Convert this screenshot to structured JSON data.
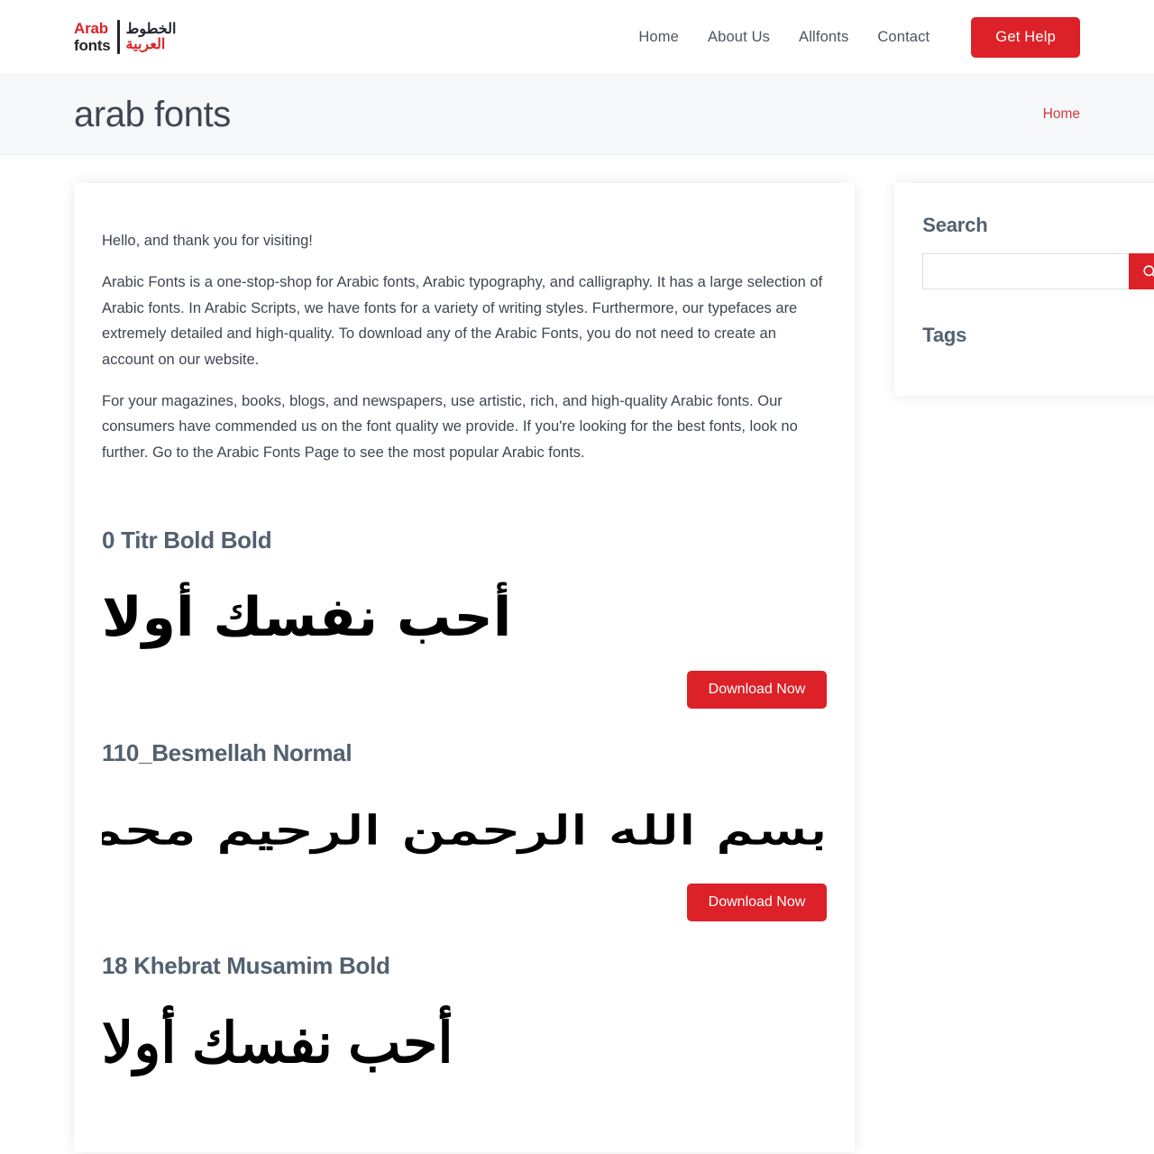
{
  "header": {
    "logo": {
      "latin_top": "Arab",
      "latin_bottom": "fonts",
      "arabic_top": "الخطوط",
      "arabic_bottom": "العربية",
      "accent_color": "#dc2128",
      "dark_color": "#22262b"
    },
    "nav": [
      {
        "label": "Home",
        "name": "nav-home"
      },
      {
        "label": "About Us",
        "name": "nav-about-us"
      },
      {
        "label": "Allfonts",
        "name": "nav-allfonts"
      },
      {
        "label": "Contact",
        "name": "nav-contact"
      }
    ],
    "cta": {
      "label": "Get Help"
    }
  },
  "hero": {
    "title": "arab fonts",
    "breadcrumb": "Home",
    "background": "#f6f8fa",
    "breadcrumb_color": "#d63844"
  },
  "intro": {
    "p1": "Hello, and thank you for visiting!",
    "p2": "Arabic Fonts is a one-stop-shop for Arabic fonts, Arabic typography, and calligraphy. It has a large selection of Arabic fonts. In Arabic Scripts, we have fonts for a variety of writing styles. Furthermore, our typefaces are extremely detailed and high-quality. To download any of the Arabic Fonts, you do not need to create an account on our website.",
    "p3": "For your magazines, books, blogs, and newspapers, use artistic, rich, and high-quality Arabic fonts. Our consumers have commended us on the font quality we provide. If you're looking for the best fonts, look no further. Go to the Arabic Fonts Page to see the most popular Arabic fonts."
  },
  "fonts": [
    {
      "name": "0 Titr Bold Bold",
      "preview_text": "أحب نفسك أولا",
      "download_label": "Download Now"
    },
    {
      "name": "110_Besmellah Normal",
      "preview_text": "بسم الله الرحمن الرحيم محمد رسول الله",
      "download_label": "Download Now"
    },
    {
      "name": "18 Khebrat Musamim Bold",
      "preview_text": "أحب نفسك أولا",
      "download_label": "Download Now"
    }
  ],
  "sidebar": {
    "search": {
      "title": "Search",
      "value": "",
      "placeholder": "",
      "button_icon": "search-icon",
      "button_color": "#dc2128"
    },
    "tags": {
      "title": "Tags",
      "items": []
    }
  }
}
